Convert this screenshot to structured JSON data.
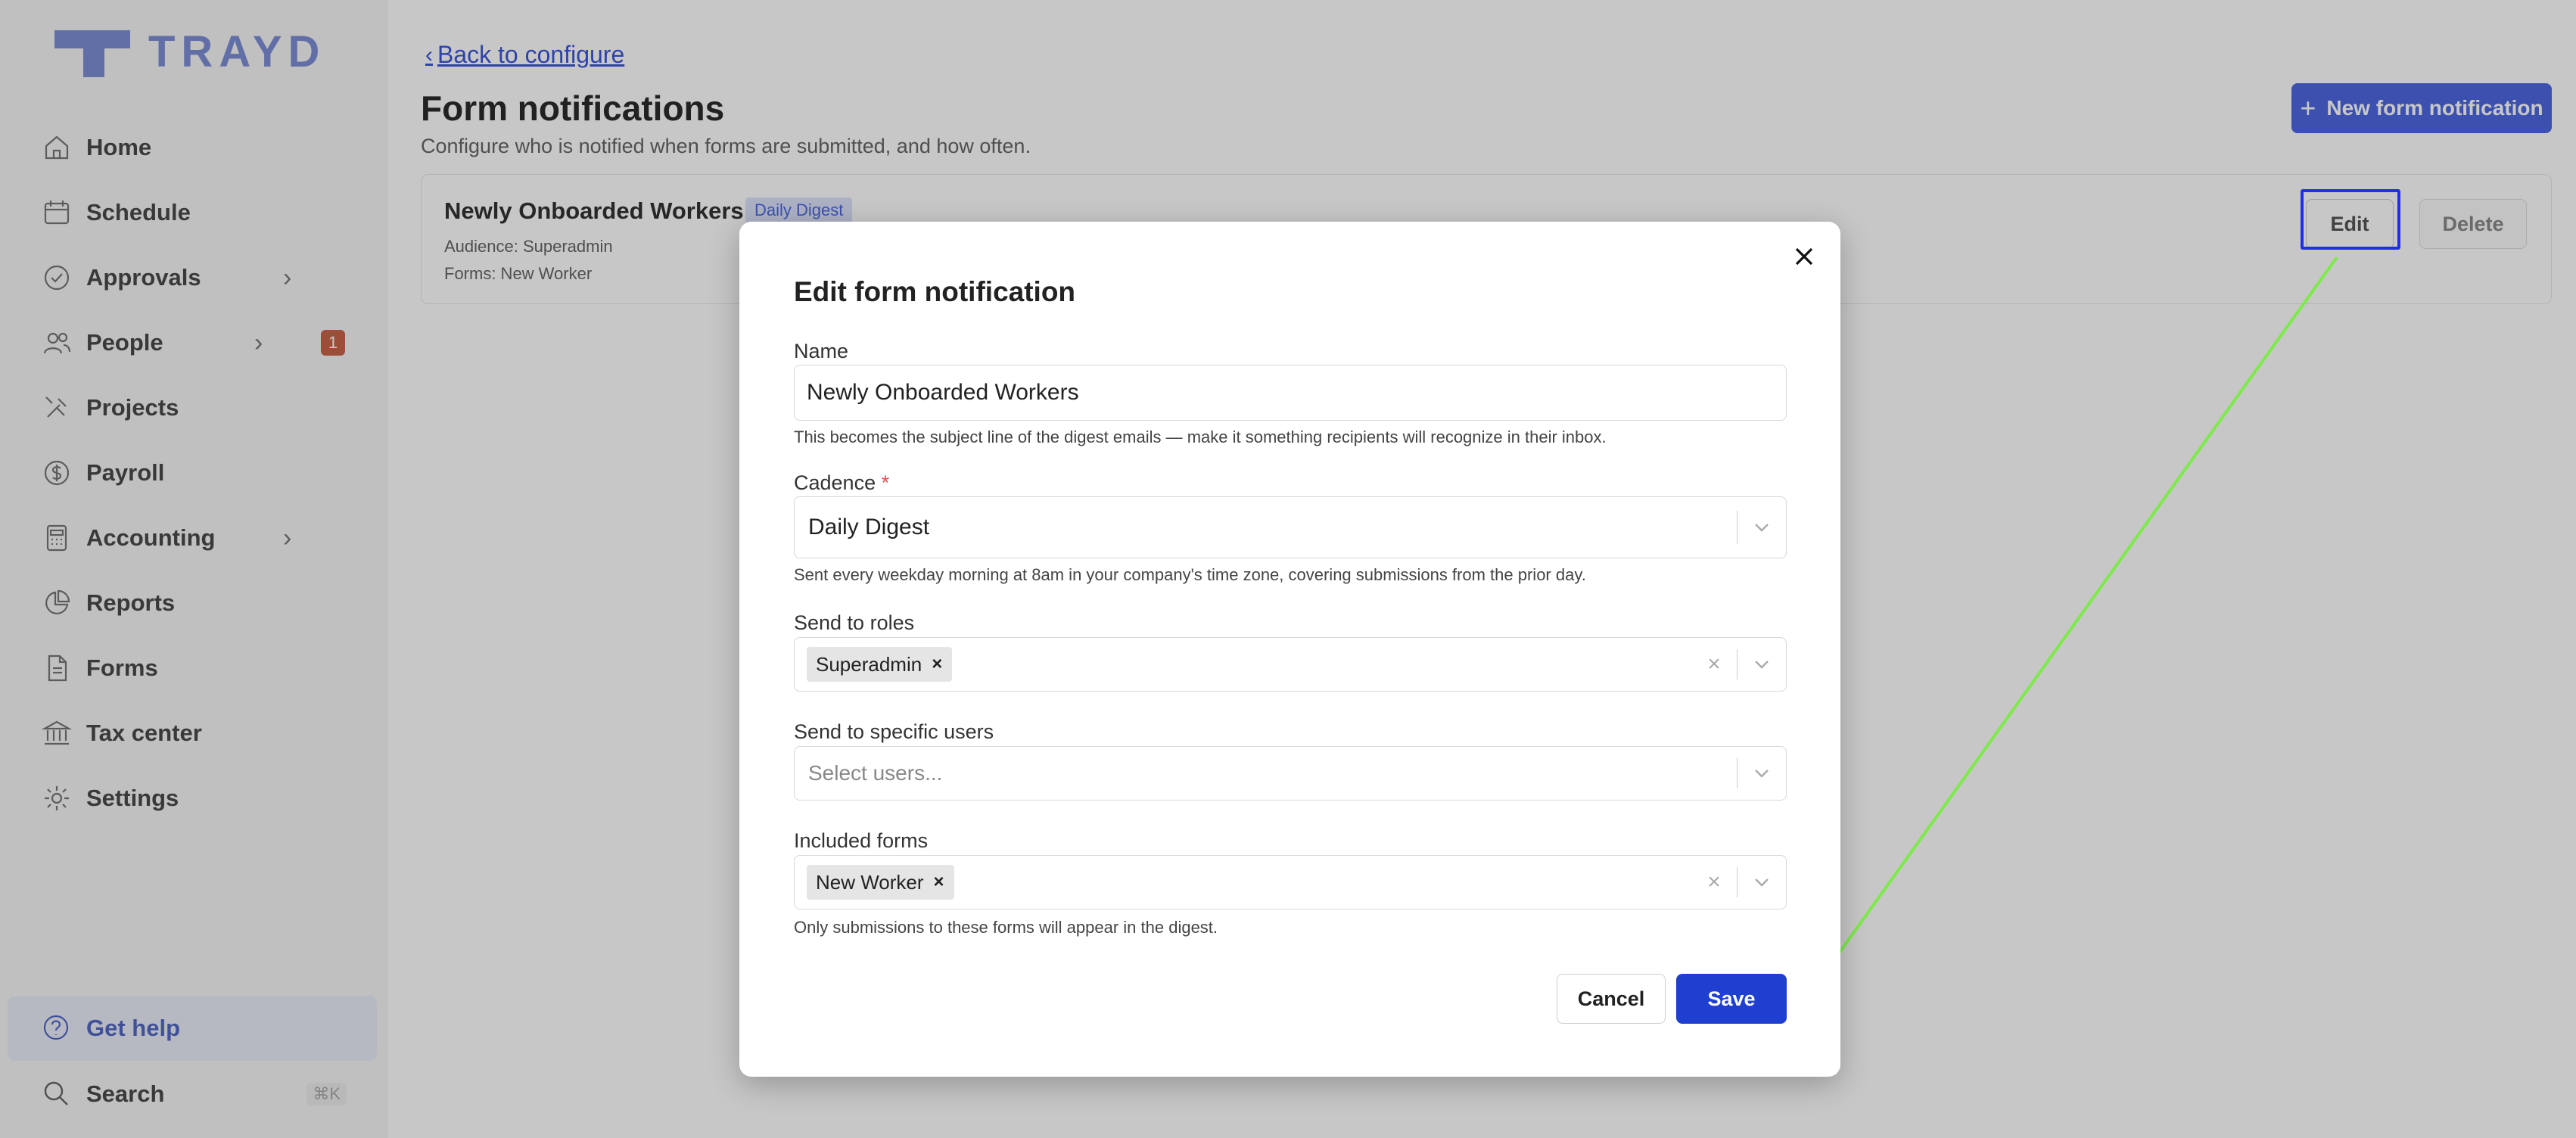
{
  "brand": {
    "name": "TRAYD",
    "logo_color": "#7e8fd6"
  },
  "sidebar": {
    "items": [
      {
        "label": "Home",
        "icon": "home-icon"
      },
      {
        "label": "Schedule",
        "icon": "calendar-icon"
      },
      {
        "label": "Approvals",
        "icon": "check-circle-icon",
        "has_chevron": true
      },
      {
        "label": "People",
        "icon": "people-icon",
        "has_chevron": true,
        "badge": "1"
      },
      {
        "label": "Projects",
        "icon": "tools-icon"
      },
      {
        "label": "Payroll",
        "icon": "dollar-icon"
      },
      {
        "label": "Accounting",
        "icon": "calculator-icon",
        "has_chevron": true
      },
      {
        "label": "Reports",
        "icon": "pie-chart-icon"
      },
      {
        "label": "Forms",
        "icon": "document-icon"
      },
      {
        "label": "Tax center",
        "icon": "bank-icon"
      },
      {
        "label": "Settings",
        "icon": "gear-icon"
      }
    ],
    "help_label": "Get help",
    "search_label": "Search",
    "search_shortcut": "⌘K"
  },
  "main": {
    "back_link": "Back to configure",
    "title": "Form notifications",
    "subtitle": "Configure who is notified when forms are submitted, and how often.",
    "new_button": "New form notification",
    "card": {
      "name": "Newly Onboarded Workers",
      "tag": "Daily Digest",
      "audience": "Audience: Superadmin",
      "forms": "Forms: New Worker",
      "edit_label": "Edit",
      "delete_label": "Delete"
    }
  },
  "modal": {
    "title": "Edit form notification",
    "name_label": "Name",
    "name_value": "Newly Onboarded Workers",
    "name_help": "This becomes the subject line of the digest emails — make it something recipients will recognize in their inbox.",
    "cadence_label": "Cadence",
    "cadence_required": "*",
    "cadence_value": "Daily Digest",
    "cadence_help": "Sent every weekday morning at 8am in your company's time zone, covering submissions from the prior day.",
    "roles_label": "Send to roles",
    "roles_chip": "Superadmin",
    "users_label": "Send to specific users",
    "users_placeholder": "Select users...",
    "forms_label": "Included forms",
    "forms_chip": "New Worker",
    "forms_help": "Only submissions to these forms will appear in the digest.",
    "cancel_label": "Cancel",
    "save_label": "Save"
  },
  "colors": {
    "accent": "#1e3fd0",
    "highlight_box": "#1f2fe8",
    "arrow": "#7dea4a"
  }
}
